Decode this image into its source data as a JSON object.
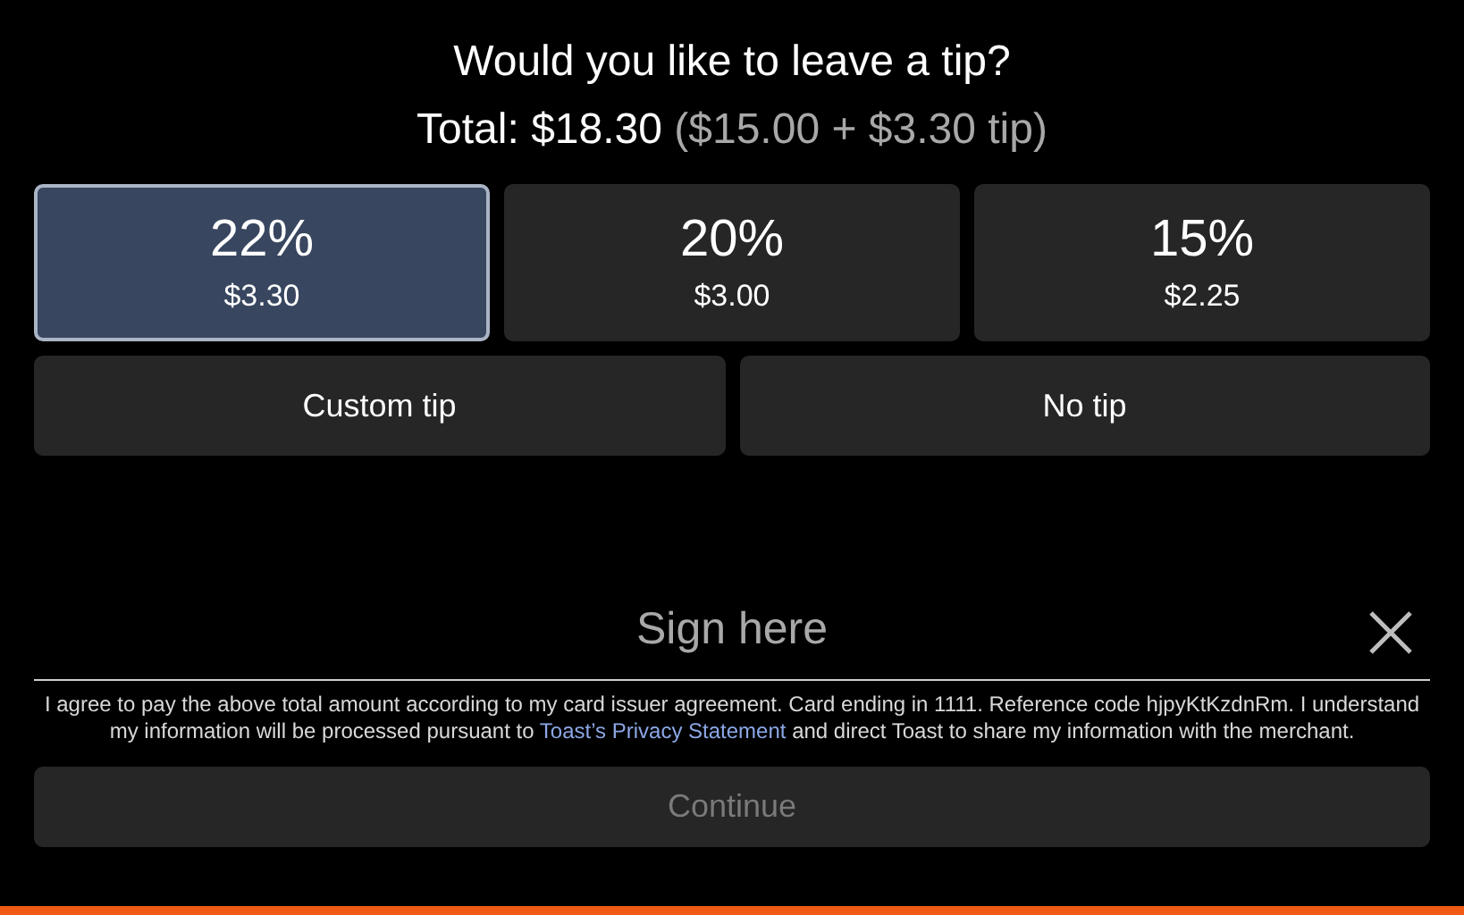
{
  "prompt": {
    "title": "Would you like to leave a tip?",
    "total": "Total: $18.30",
    "breakdown": "($15.00 + $3.30 tip)"
  },
  "tip_options": [
    {
      "percent": "22%",
      "amount": "$3.30",
      "selected": true
    },
    {
      "percent": "20%",
      "amount": "$3.00",
      "selected": false
    },
    {
      "percent": "15%",
      "amount": "$2.25",
      "selected": false
    }
  ],
  "other_options": [
    {
      "label": "Custom tip",
      "selected": false
    },
    {
      "label": "No tip",
      "selected": false
    }
  ],
  "signature": {
    "placeholder": "Sign here"
  },
  "agreement": {
    "before": "I agree to pay the above total amount according to my card issuer agreement. Card ending in 1111. Reference code hjpyKtKzdnRm. I understand my information will be processed pursuant to",
    "link": "Toast’s Privacy Statement",
    "after": "and direct Toast to share my information with the merchant."
  },
  "continue_button": {
    "label": "Continue",
    "disabled": true
  }
}
